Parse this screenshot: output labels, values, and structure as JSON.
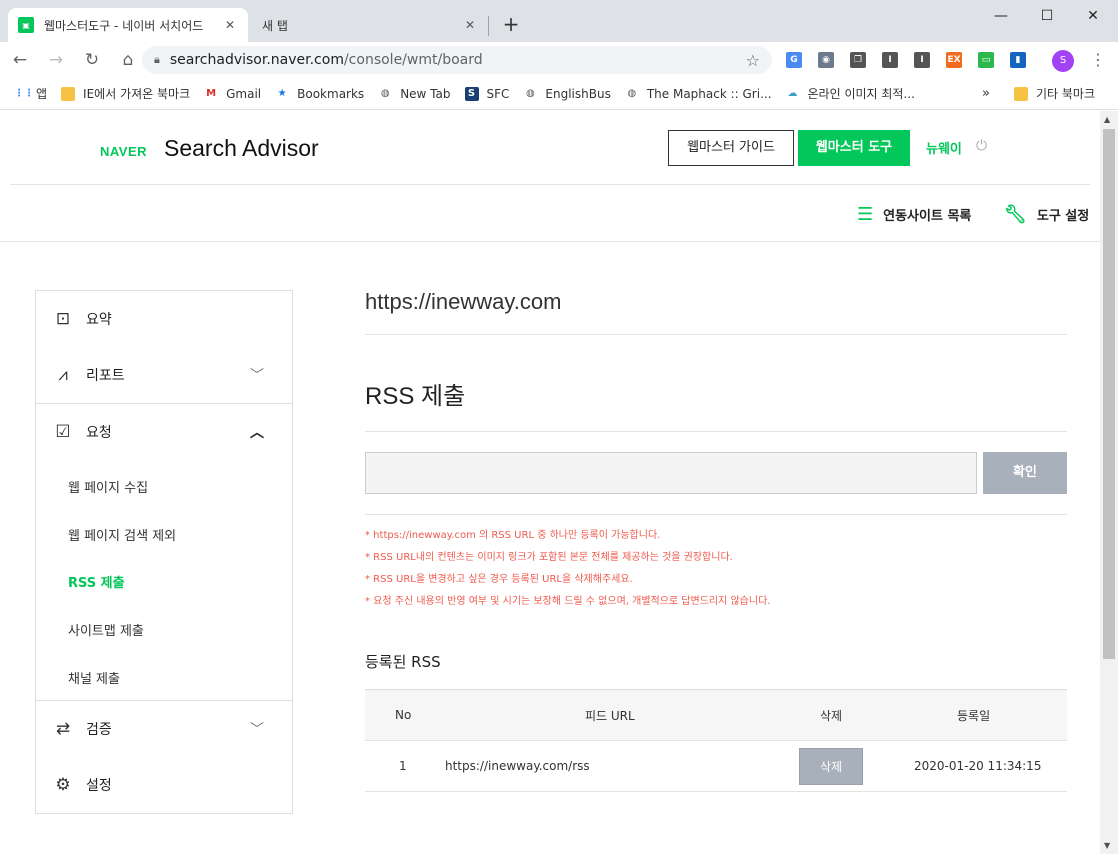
{
  "browser": {
    "active_tab_title": "웹마스터도구 - 네이버 서치어드",
    "inactive_tab_title": "새 탭",
    "new_tab": "+",
    "url_host": "searchadvisor.naver.com",
    "url_path": "/console/wmt/board",
    "profile_initial": "S",
    "bookmarks": [
      {
        "label": "앱",
        "icon": "apps-icon",
        "color": "#4285f4"
      },
      {
        "label": "IE에서 가져온 북마크",
        "icon": "folder-icon",
        "color": "#f6c244"
      },
      {
        "label": "Gmail",
        "icon": "gmail-icon",
        "color": "#d93025"
      },
      {
        "label": "Bookmarks",
        "icon": "star-icon",
        "color": "#1a73e8"
      },
      {
        "label": "New Tab",
        "icon": "globe-icon",
        "color": "#555"
      },
      {
        "label": "SFC",
        "icon": "sfc-icon",
        "color": "#1a3e72"
      },
      {
        "label": "EnglishBus",
        "icon": "globe-icon",
        "color": "#555"
      },
      {
        "label": "The Maphack :: Gri...",
        "icon": "globe-icon",
        "color": "#555"
      },
      {
        "label": "온라인 이미지 최적...",
        "icon": "cloud-icon",
        "color": "#3aa0c8"
      }
    ],
    "other_bookmarks": "기타 북마크"
  },
  "header": {
    "logo": "NAVER",
    "title": "Search Advisor",
    "guide_button": "웹마스터 가이드",
    "tool_button": "웹마스터 도구",
    "user": "뉴웨이"
  },
  "subbar": {
    "site_list": "연동사이트 목록",
    "tool_settings": "도구 설정"
  },
  "sidebar": {
    "summary": "요약",
    "report": "리포트",
    "request": "요청",
    "request_items": [
      "웹 페이지 수집",
      "웹 페이지 검색 제외",
      "RSS 제출",
      "사이트맵 제출",
      "채널 제출"
    ],
    "verify": "검증",
    "settings": "설정"
  },
  "main": {
    "site_url": "https://inewway.com",
    "section_title": "RSS 제출",
    "input_value": "",
    "confirm_button": "확인",
    "notes": [
      "* https://inewway.com 의 RSS URL 중 하나만 등록이 가능합니다.",
      "* RSS URL내의 컨텐츠는 이미지 링크가 포함된 본문 전체를 제공하는 것을 권장합니다.",
      "* RSS URL을 변경하고 싶은 경우 등록된 URL을 삭제해주세요.",
      "* 요청 주신 내용의 반영 여부 및 시기는 보장해 드릴 수 없으며, 개별적으로 답변드리지 않습니다."
    ],
    "registered_title": "등록된 RSS",
    "table": {
      "headers": [
        "No",
        "피드 URL",
        "삭제",
        "등록일"
      ],
      "rows": [
        {
          "no": "1",
          "url": "https://inewway.com/rss",
          "delete": "삭제",
          "date": "2020-01-20 11:34:15"
        }
      ]
    }
  },
  "colors": {
    "brand_green": "#03c75a",
    "note_red": "#ef5a4c",
    "button_gray": "#a7b0bb"
  }
}
